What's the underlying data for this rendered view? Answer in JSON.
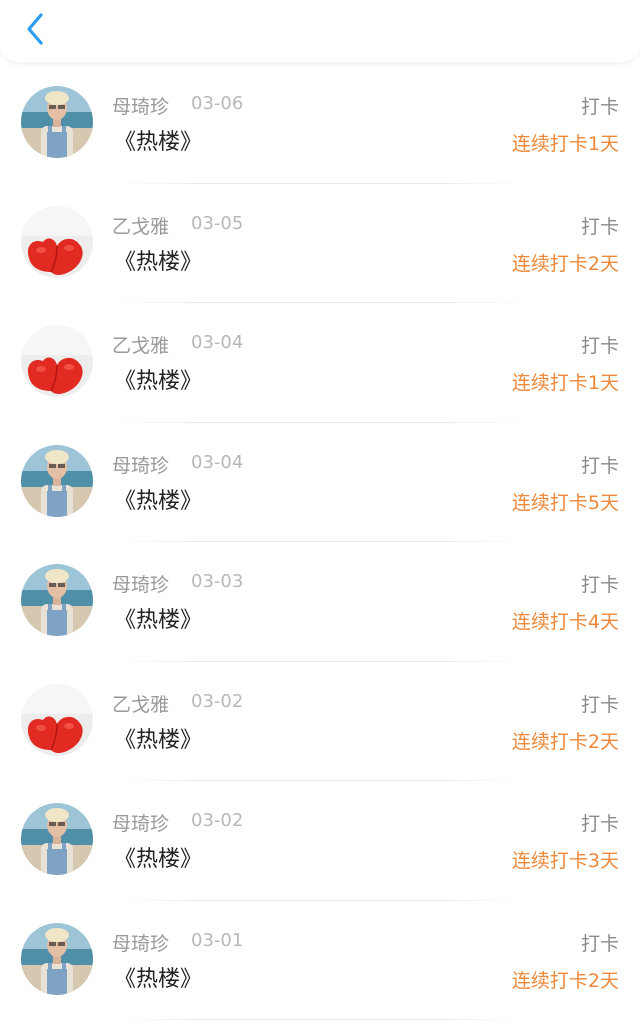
{
  "header": {
    "back_icon": "chevron-left-icon",
    "accent_color": "#2a9df4"
  },
  "colors": {
    "streak": "#f0883a",
    "name": "#9a9a9a",
    "date": "#b8b8b8"
  },
  "items": [
    {
      "avatar": "boy",
      "name": "母琦珍",
      "date": "03-06",
      "book": "《热楼》",
      "action": "打卡",
      "streak": "连续打卡1天"
    },
    {
      "avatar": "heart",
      "name": "乙戈雅",
      "date": "03-05",
      "book": "《热楼》",
      "action": "打卡",
      "streak": "连续打卡2天"
    },
    {
      "avatar": "heart",
      "name": "乙戈雅",
      "date": "03-04",
      "book": "《热楼》",
      "action": "打卡",
      "streak": "连续打卡1天"
    },
    {
      "avatar": "boy",
      "name": "母琦珍",
      "date": "03-04",
      "book": "《热楼》",
      "action": "打卡",
      "streak": "连续打卡5天"
    },
    {
      "avatar": "boy",
      "name": "母琦珍",
      "date": "03-03",
      "book": "《热楼》",
      "action": "打卡",
      "streak": "连续打卡4天"
    },
    {
      "avatar": "heart",
      "name": "乙戈雅",
      "date": "03-02",
      "book": "《热楼》",
      "action": "打卡",
      "streak": "连续打卡2天"
    },
    {
      "avatar": "boy",
      "name": "母琦珍",
      "date": "03-02",
      "book": "《热楼》",
      "action": "打卡",
      "streak": "连续打卡3天"
    },
    {
      "avatar": "boy",
      "name": "母琦珍",
      "date": "03-01",
      "book": "《热楼》",
      "action": "打卡",
      "streak": "连续打卡2天"
    }
  ]
}
